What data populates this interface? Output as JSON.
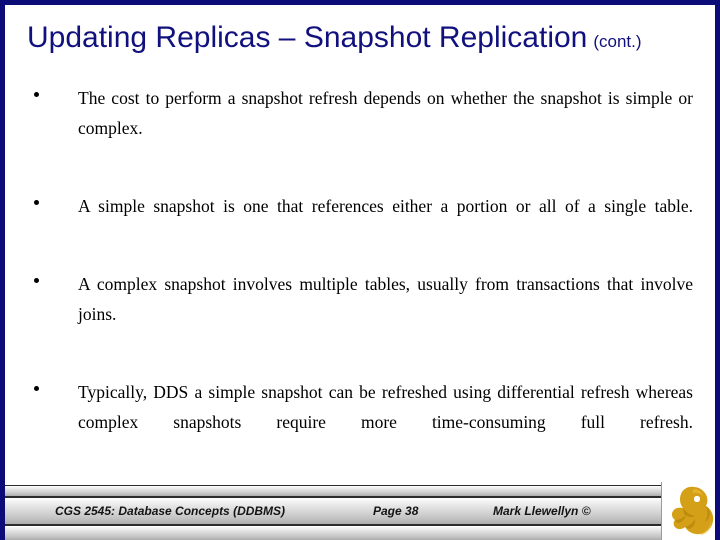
{
  "slide": {
    "title": "Updating Replicas – Snapshot Replication",
    "title_suffix": "(cont.)",
    "accent_color": "#11117e",
    "border_color": "#0c0c78",
    "background_color": "#ffffff",
    "bullets": [
      {
        "marker": "•",
        "text": "The cost to perform a snapshot refresh depends on whether the snapshot is simple or complex."
      },
      {
        "marker": "•",
        "text": "A simple snapshot is one that references either a portion or all of a single table."
      },
      {
        "marker": "•",
        "text": "A complex snapshot involves multiple tables, usually from transactions that involve joins."
      },
      {
        "marker": "•",
        "text": "Typically, DDS a simple snapshot can be refreshed using differential refresh whereas complex snapshots require more time-consuming full refresh."
      }
    ]
  },
  "footer": {
    "course": "CGS 2545: Database Concepts  (DDBMS)",
    "page": "Page 38",
    "author": "Mark Llewellyn ©",
    "logo_name": "ucf-pegasus-logo",
    "logo_color": "#d4a017"
  }
}
